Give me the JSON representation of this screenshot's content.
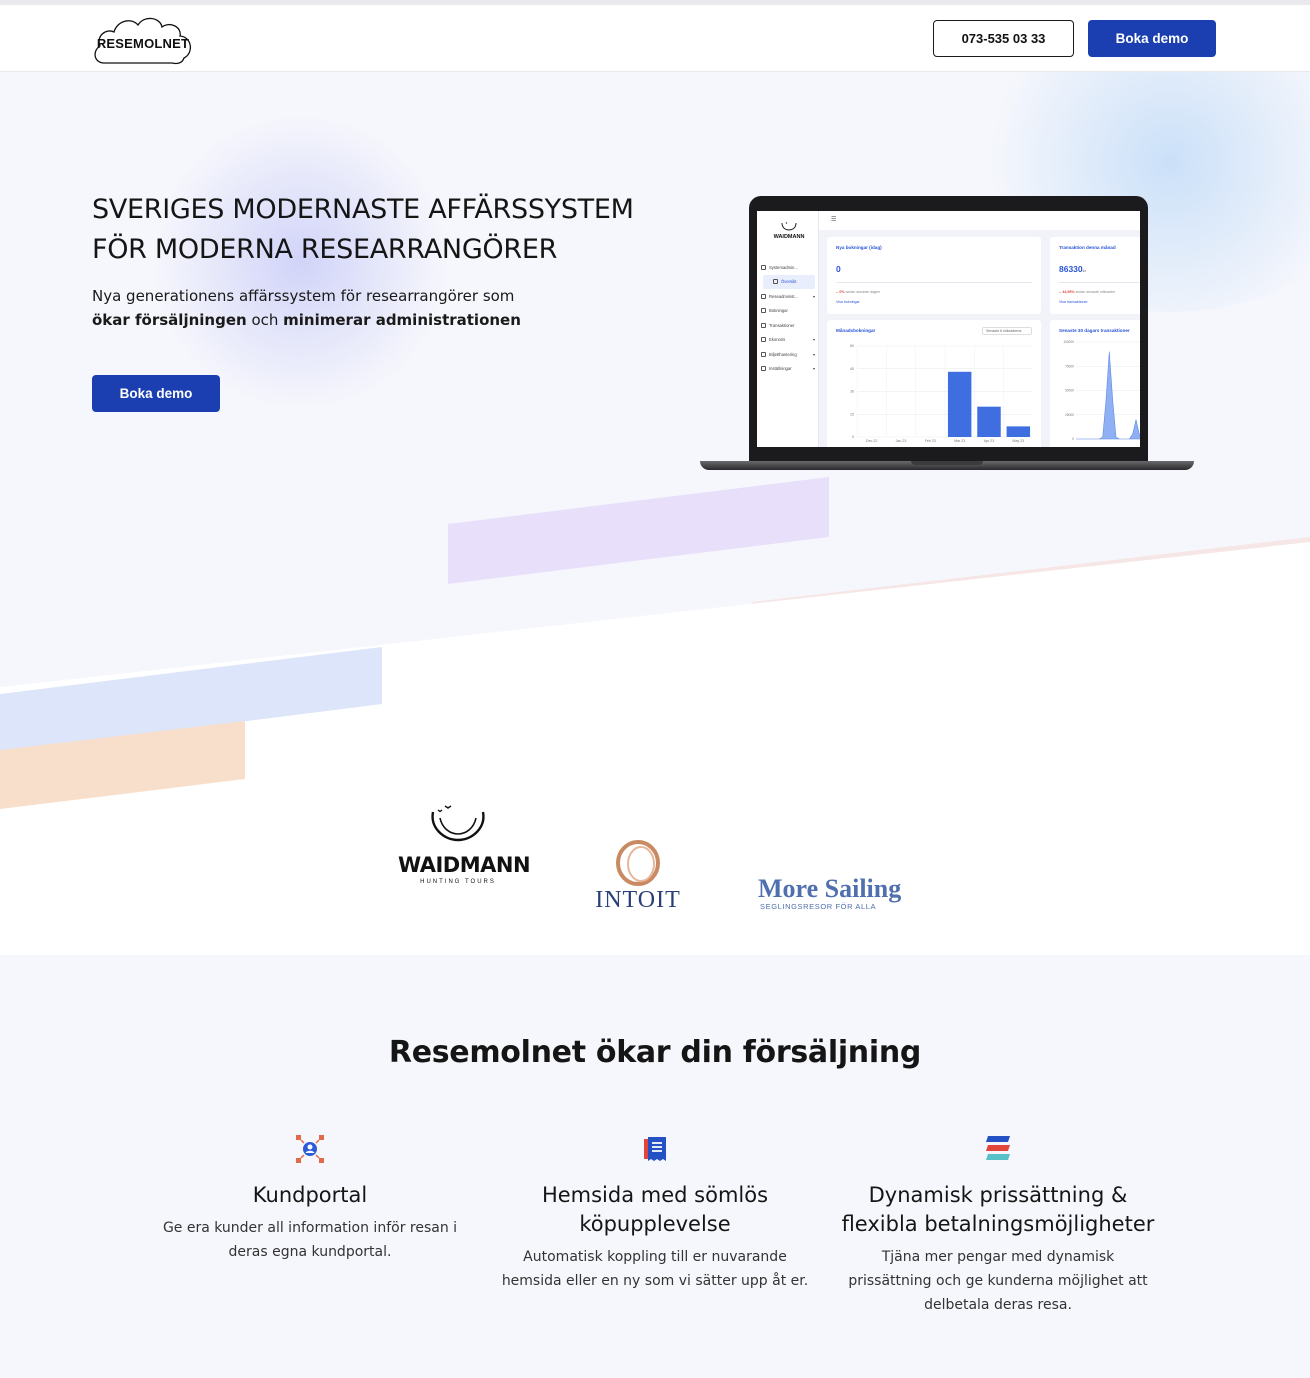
{
  "header": {
    "logo_text": "RESEMOLNET",
    "phone": "073-535 03 33",
    "demo_label": "Boka demo"
  },
  "hero": {
    "title_line1": "SVERIGES MODERNASTE AFFÄRSSYSTEM",
    "title_line2": "FÖR MODERNA RESEARRANGÖRER",
    "sub_line1": "Nya generationens affärssystem för researrangörer som",
    "sub_bold1": "ökar försäljningen",
    "sub_mid": " och ",
    "sub_bold2": "minimerar administrationen",
    "cta_label": "Boka demo"
  },
  "dashboard": {
    "logo": "WAIDMANN",
    "menu": [
      {
        "label": "Systemadmin...",
        "chev": ""
      },
      {
        "label": "Översikt",
        "chev": ""
      },
      {
        "label": "Reseadminist...",
        "chev": "▾"
      },
      {
        "label": "Bokningar",
        "chev": ""
      },
      {
        "label": "Transaktioner",
        "chev": ""
      },
      {
        "label": "Ekonomi",
        "chev": "▾"
      },
      {
        "label": "Biljetthantering",
        "chev": "▾"
      },
      {
        "label": "Inställningar",
        "chev": "▾"
      }
    ],
    "card1": {
      "title": "Nya bokningar (idag)",
      "value": "0",
      "delta": "-- 0%",
      "delta_note": " sedan senaste dagen",
      "link": "Visa bokningar"
    },
    "card2": {
      "title": "Transaktion denna månad",
      "value": "86330",
      "unit": "kr",
      "delta": "-- 44,95%",
      "delta_note": " sedan senaste månaden",
      "link": "Visa transaktioner"
    },
    "card3": {
      "title": "Månadsbokningar",
      "select": "Senaste 6 månaderna"
    },
    "card4": {
      "title": "Senaste 30 dagars transaktioner"
    },
    "bar_chart": {
      "categories": [
        "Dec 22",
        "Jan 23",
        "Feb 23",
        "Mar 23",
        "Apr 23",
        "May 23"
      ],
      "values": [
        0,
        0,
        0,
        43,
        20,
        7
      ],
      "ylim": [
        0,
        60
      ],
      "yticks": [
        "60",
        "45",
        "30",
        "15",
        "0"
      ]
    },
    "line_chart": {
      "yticks": [
        "100000",
        "75000",
        "50000",
        "25000",
        "0"
      ],
      "values": [
        0,
        0,
        0,
        0,
        0,
        0,
        0,
        0,
        2000,
        40000,
        90000,
        40000,
        2000,
        0,
        0,
        0,
        0,
        5000,
        20000,
        5000,
        0,
        0
      ],
      "ylim": [
        0,
        100000
      ]
    }
  },
  "partners": {
    "waidmann": {
      "name": "WAIDMANN",
      "tagline": "HUNTING TOURS"
    },
    "intoit": {
      "name": "INTOIT"
    },
    "sailing": {
      "name": "More Sailing",
      "tagline": "SEGLINGSRESOR FÖR ALLA"
    }
  },
  "features": {
    "title": "Resemolnet ökar din försäljning",
    "items": [
      {
        "title_line1": "Kundportal",
        "title_line2": "",
        "text": "Ge era kunder all information inför resan i deras egna kundportal."
      },
      {
        "title_line1": "Hemsida med sömlös",
        "title_line2": "köpupplevelse",
        "text": "Automatisk koppling till er nuvarande hemsida eller en ny som vi sätter upp åt er."
      },
      {
        "title_line1": "Dynamisk prissättning &",
        "title_line2": "flexibla betalningsmöjligheter",
        "text": "Tjäna mer pengar med dynamisk prissättning och ge kunderna möjlighet att delbetala deras resa."
      }
    ]
  },
  "colors": {
    "brand_blue": "#1b3fb0",
    "accent_blue": "#2a54d6",
    "stripe_purple": "#e7e0fa",
    "stripe_pink": "#f6e6e6",
    "stripe_blue": "#5b8df2",
    "stripe_lightblue": "#dce5fa",
    "stripe_peach": "#f8dfcb"
  }
}
